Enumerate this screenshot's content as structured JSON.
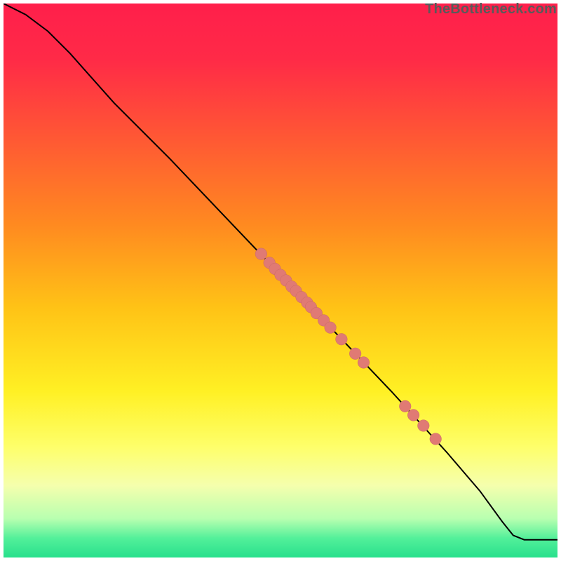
{
  "watermark": "TheBottleneck.com",
  "colors": {
    "gradient_stops": [
      {
        "offset": 0.0,
        "color": "#ff1f4b"
      },
      {
        "offset": 0.1,
        "color": "#ff2a47"
      },
      {
        "offset": 0.25,
        "color": "#ff5a33"
      },
      {
        "offset": 0.4,
        "color": "#ff8a20"
      },
      {
        "offset": 0.55,
        "color": "#ffc316"
      },
      {
        "offset": 0.7,
        "color": "#fff024"
      },
      {
        "offset": 0.8,
        "color": "#feff6a"
      },
      {
        "offset": 0.87,
        "color": "#f5ffad"
      },
      {
        "offset": 0.93,
        "color": "#b8ffb0"
      },
      {
        "offset": 0.965,
        "color": "#53f09a"
      },
      {
        "offset": 1.0,
        "color": "#28e08c"
      }
    ],
    "line": "#000000",
    "dot_fill": "#e07a74",
    "dot_stroke": "#c96a64"
  },
  "chart_data": {
    "type": "line",
    "title": "",
    "xlabel": "",
    "ylabel": "",
    "xlim": [
      0,
      100
    ],
    "ylim": [
      0,
      100
    ],
    "legend": false,
    "grid": false,
    "series": [
      {
        "name": "curve",
        "x": [
          0,
          4,
          8,
          12,
          20,
          30,
          40,
          50,
          60,
          70,
          80,
          86,
          90,
          92,
          94,
          100
        ],
        "y": [
          100,
          98,
          95,
          91,
          82,
          72,
          61.5,
          51,
          40.5,
          30,
          19,
          12,
          6.5,
          4,
          3.2,
          3.2
        ]
      }
    ],
    "points": [
      {
        "x": 46.5,
        "y": 54.8
      },
      {
        "x": 48.0,
        "y": 53.2
      },
      {
        "x": 49.0,
        "y": 52.1
      },
      {
        "x": 50.0,
        "y": 51.0
      },
      {
        "x": 51.0,
        "y": 50.0
      },
      {
        "x": 52.0,
        "y": 48.9
      },
      {
        "x": 52.8,
        "y": 48.1
      },
      {
        "x": 53.8,
        "y": 47.0
      },
      {
        "x": 54.8,
        "y": 46.0
      },
      {
        "x": 55.5,
        "y": 45.2
      },
      {
        "x": 56.5,
        "y": 44.1
      },
      {
        "x": 57.8,
        "y": 42.8
      },
      {
        "x": 59.0,
        "y": 41.5
      },
      {
        "x": 61.0,
        "y": 39.4
      },
      {
        "x": 63.5,
        "y": 36.8
      },
      {
        "x": 65.0,
        "y": 35.2
      },
      {
        "x": 72.5,
        "y": 27.3
      },
      {
        "x": 74.0,
        "y": 25.7
      },
      {
        "x": 75.8,
        "y": 23.8
      },
      {
        "x": 78.0,
        "y": 21.4
      }
    ],
    "dot_radius_data_units": 1.05
  }
}
